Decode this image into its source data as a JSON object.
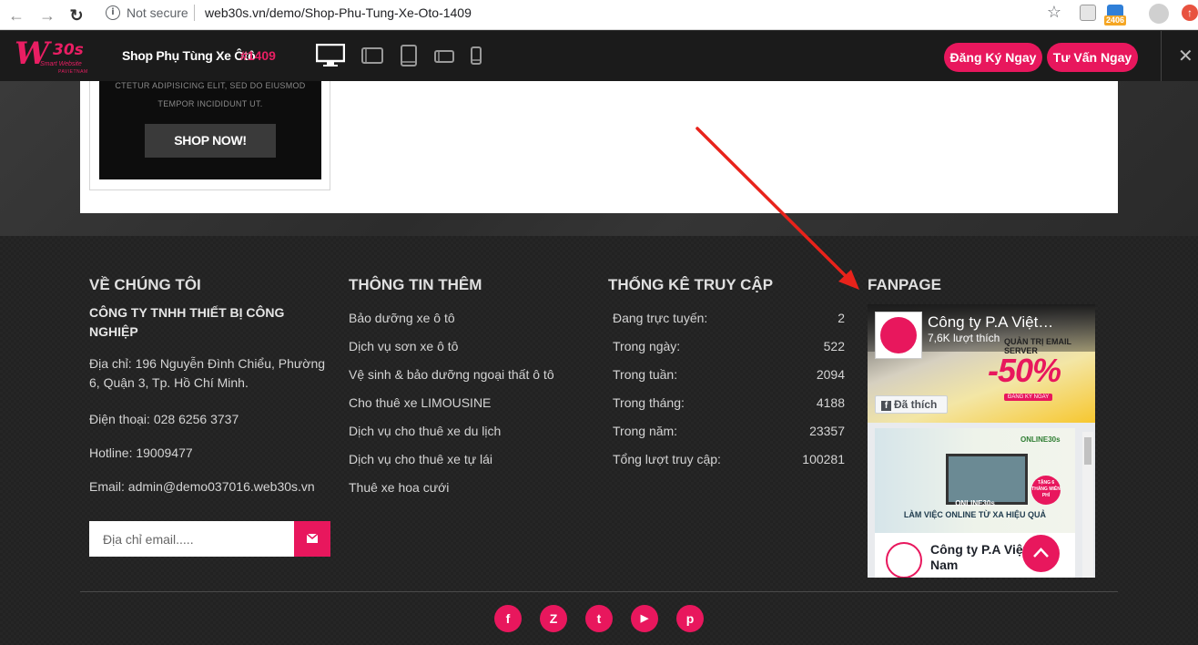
{
  "browser": {
    "security_label": "Not secure",
    "url": "web30s.vn/demo/Shop-Phu-Tung-Xe-Oto-1409",
    "extension_badge": "2406",
    "icons": [
      "back-icon",
      "forward-icon",
      "reload-icon",
      "info-icon",
      "star-icon"
    ]
  },
  "demo_bar": {
    "logo_main": "W",
    "logo_brand": "30s",
    "logo_tagline": "Smart Website",
    "logo_company": "PAVIETNAM",
    "title": "Shop Phụ Tùng Xe Ôtô",
    "number": "#1409",
    "register_label": "Đăng Ký Ngay",
    "consult_label": "Tư Vấn Ngay",
    "close_label": "✕",
    "devices": [
      "desktop-icon",
      "tablet-landscape-icon",
      "tablet-portrait-icon",
      "phone-landscape-icon",
      "phone-portrait-icon"
    ]
  },
  "promo": {
    "line1": "CTETUR ADIPISICING ELIT, SED DO EIUSMOD",
    "line2": "TEMPOR INCIDIDUNT UT.",
    "button_label": "SHOP NOW!"
  },
  "footer": {
    "about": {
      "heading": "VỀ CHÚNG TÔI",
      "company": "CÔNG TY TNHH THIẾT BỊ CÔNG NGHIỆP",
      "address": "Địa chỉ: 196 Nguyễn Đình Chiểu, Phường 6, Quận 3, Tp. Hồ Chí Minh.",
      "phone": "Điện thoại: 028 6256 3737",
      "hotline": "Hotline: 19009477",
      "email": "Email: admin@demo037016.web30s.vn",
      "email_placeholder": "Địa chỉ email....."
    },
    "info": {
      "heading": "THÔNG TIN THÊM",
      "links": [
        "Bảo dưỡng xe ô tô",
        "Dịch vụ sơn xe ô tô",
        "Vệ sinh & bảo dưỡng ngoại thất ô tô",
        "Cho thuê xe LIMOUSINE",
        "Dịch vụ cho thuê xe du lịch",
        "Dịch vụ cho thuê xe tự lái",
        "Thuê xe hoa cưới"
      ]
    },
    "stats": {
      "heading": "THỐNG KÊ TRUY CẬP",
      "rows": [
        {
          "label": "Đang trực tuyến:",
          "value": "2"
        },
        {
          "label": "Trong ngày:",
          "value": "522"
        },
        {
          "label": "Trong tuần:",
          "value": "2094"
        },
        {
          "label": "Trong tháng:",
          "value": "4188"
        },
        {
          "label": "Trong năm:",
          "value": "23357"
        },
        {
          "label": "Tổng lượt truy cập:",
          "value": "100281"
        }
      ]
    },
    "fanpage": {
      "heading": "FANPAGE",
      "page_name": "Công ty P.A Việt…",
      "likes": "7,6K lượt thích",
      "liked_label": "Đã thích",
      "cover_text1": "QUẢN TRỊ EMAIL SERVER",
      "cover_text2": "-50%",
      "cover_text3": "ĐĂNG KÝ NGAY",
      "post_brand": "ONLINE30s",
      "post_title1": "ONLINE30s",
      "post_title2": "LÀM VIỆC ONLINE TỪ XA HIỆU QUẢ",
      "post_badge": "TẶNG 6 THÁNG MIỄN PHÍ",
      "post_author": "Công ty P.A Việt Nam"
    },
    "social": [
      {
        "icon": "facebook-icon",
        "glyph": "f"
      },
      {
        "icon": "zalo-icon",
        "glyph": "Z"
      },
      {
        "icon": "twitter-icon",
        "glyph": "t"
      },
      {
        "icon": "youtube-icon",
        "glyph": "▶"
      },
      {
        "icon": "pinterest-icon",
        "glyph": "p"
      }
    ]
  },
  "colors": {
    "accent": "#e8175d",
    "bar": "#1b1b1b",
    "footer": "#222222",
    "arrow": "#e8231b"
  }
}
